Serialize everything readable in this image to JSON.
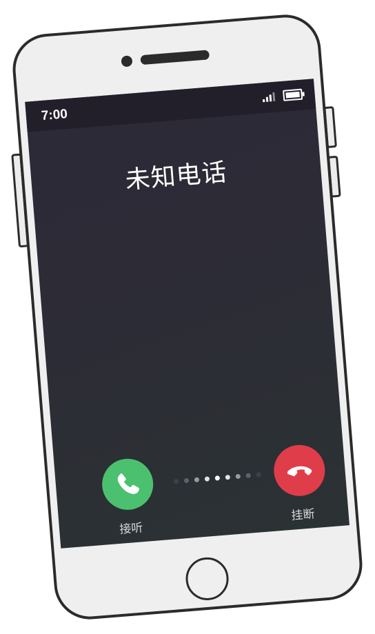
{
  "status_bar": {
    "time": "7:00",
    "signal_icon": "signal-bars-icon",
    "battery_icon": "battery-icon"
  },
  "call": {
    "caller_name": "未知电话",
    "answer": {
      "label": "接听",
      "icon": "phone-icon",
      "color": "#4bc170"
    },
    "hangup": {
      "label": "挂断",
      "icon": "phone-hangup-icon",
      "color": "#e03d4b"
    },
    "swipe_hint_icon": "swipe-dots-icon"
  },
  "device": {
    "home_button_icon": "home-button-icon"
  }
}
